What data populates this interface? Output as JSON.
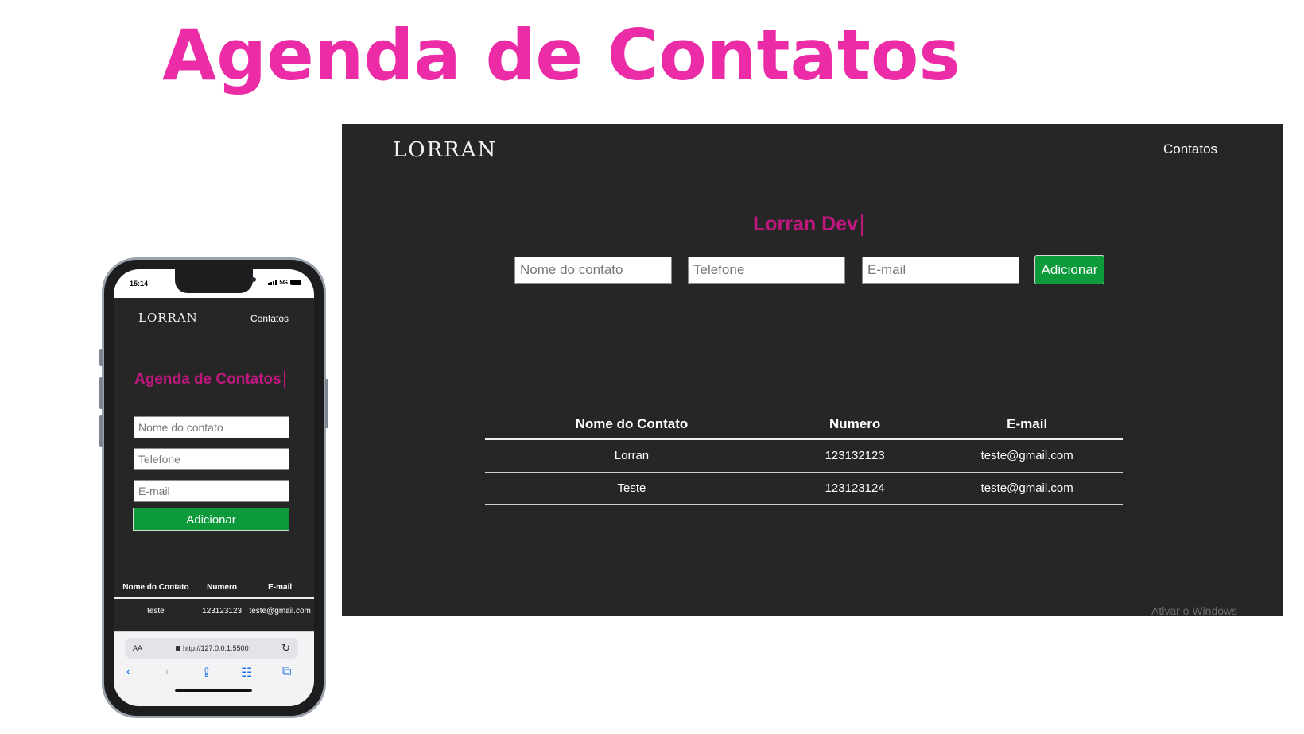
{
  "hero": {
    "title": "Agenda de Contatos"
  },
  "desktop": {
    "brand": "LORRAN",
    "nav": {
      "contatos": "Contatos"
    },
    "app_title": "Lorran Dev",
    "form": {
      "name_placeholder": "Nome do contato",
      "phone_placeholder": "Telefone",
      "email_placeholder": "E-mail",
      "add_label": "Adicionar"
    },
    "table": {
      "headers": [
        "Nome do Contato",
        "Numero",
        "E-mail"
      ],
      "rows": [
        [
          "Lorran",
          "123132123",
          "teste@gmail.com"
        ],
        [
          "Teste",
          "123123124",
          "teste@gmail.com"
        ]
      ]
    },
    "watermark": "Ativar o Windows"
  },
  "mobile": {
    "status": {
      "time": "15:14",
      "network": "5G"
    },
    "brand": "LORRAN",
    "nav": {
      "contatos": "Contatos"
    },
    "app_title": "Agenda de Contatos",
    "form": {
      "name_placeholder": "Nome do contato",
      "phone_placeholder": "Telefone",
      "email_placeholder": "E-mail",
      "add_label": "Adicionar"
    },
    "table": {
      "headers": [
        "Nome do Contato",
        "Numero",
        "E-mail"
      ],
      "rows": [
        [
          "teste",
          "123123123",
          "teste@gmail.com"
        ]
      ]
    },
    "safari": {
      "aa": "AA",
      "url": "http://127.0.0.1:5500",
      "icons": [
        "back-icon",
        "forward-icon",
        "share-icon",
        "bookmarks-icon",
        "tabs-icon",
        "reload-icon",
        "lock-icon"
      ]
    }
  },
  "colors": {
    "hero_pink": "#ec2ca6",
    "title_magenta": "#c0177f",
    "app_background": "#262626",
    "button_green": "#0c9a3a"
  }
}
